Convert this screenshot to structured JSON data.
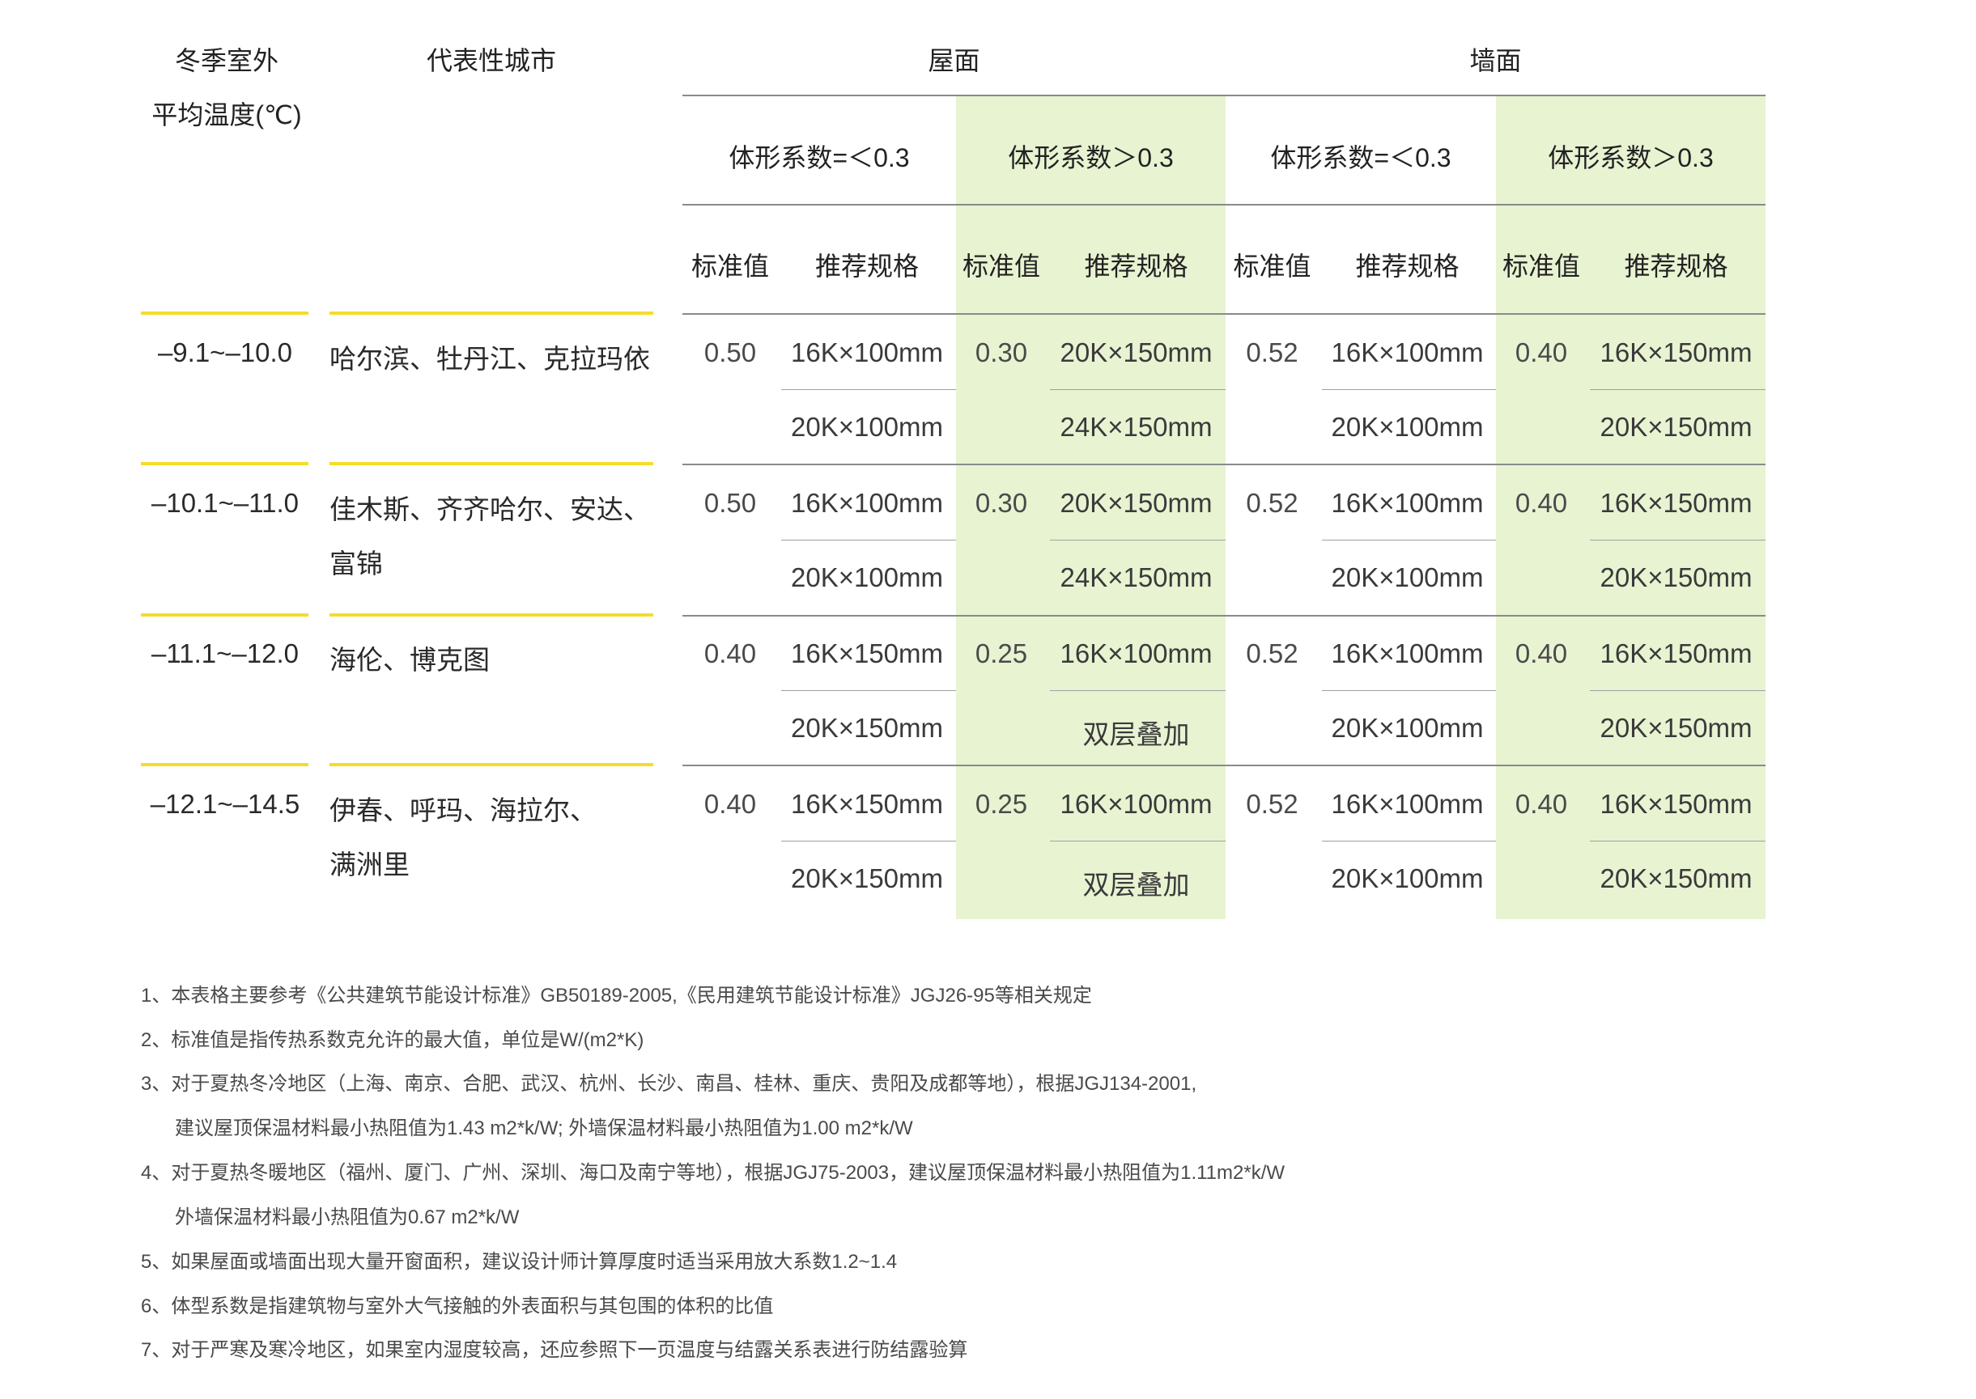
{
  "header": {
    "col1_line1": "冬季室外",
    "col1_line2": "平均温度(℃)",
    "col2": "代表性城市",
    "roof": "屋面",
    "wall": "墙面",
    "shape_le": "体形系数=＜0.3",
    "shape_gt": "体形系数＞0.3",
    "std": "标准值",
    "rec": "推荐规格"
  },
  "rows": [
    {
      "temp": "–9.1~–10.0",
      "city_line1": "哈尔滨、牡丹江、克拉玛依",
      "city_line2": "",
      "roof_le_std": "0.50",
      "roof_le_spec1": "16K×100mm",
      "roof_le_spec2": "20K×100mm",
      "roof_gt_std": "0.30",
      "roof_gt_spec1": "20K×150mm",
      "roof_gt_spec2": "24K×150mm",
      "wall_le_std": "0.52",
      "wall_le_spec1": "16K×100mm",
      "wall_le_spec2": "20K×100mm",
      "wall_gt_std": "0.40",
      "wall_gt_spec1": "16K×150mm",
      "wall_gt_spec2": "20K×150mm"
    },
    {
      "temp": "–10.1~–11.0",
      "city_line1": "佳木斯、齐齐哈尔、安达、",
      "city_line2": "富锦",
      "roof_le_std": "0.50",
      "roof_le_spec1": "16K×100mm",
      "roof_le_spec2": "20K×100mm",
      "roof_gt_std": "0.30",
      "roof_gt_spec1": "20K×150mm",
      "roof_gt_spec2": "24K×150mm",
      "wall_le_std": "0.52",
      "wall_le_spec1": "16K×100mm",
      "wall_le_spec2": "20K×100mm",
      "wall_gt_std": "0.40",
      "wall_gt_spec1": "16K×150mm",
      "wall_gt_spec2": "20K×150mm"
    },
    {
      "temp": "–11.1~–12.0",
      "city_line1": "海伦、博克图",
      "city_line2": "",
      "roof_le_std": "0.40",
      "roof_le_spec1": "16K×150mm",
      "roof_le_spec2": "20K×150mm",
      "roof_gt_std": "0.25",
      "roof_gt_spec1": "16K×100mm",
      "roof_gt_spec2": "双层叠加",
      "wall_le_std": "0.52",
      "wall_le_spec1": "16K×100mm",
      "wall_le_spec2": "20K×100mm",
      "wall_gt_std": "0.40",
      "wall_gt_spec1": "16K×150mm",
      "wall_gt_spec2": "20K×150mm"
    },
    {
      "temp": "–12.1~–14.5",
      "city_line1": "伊春、呼玛、海拉尔、",
      "city_line2": "满洲里",
      "roof_le_std": "0.40",
      "roof_le_spec1": "16K×150mm",
      "roof_le_spec2": "20K×150mm",
      "roof_gt_std": "0.25",
      "roof_gt_spec1": "16K×100mm",
      "roof_gt_spec2": "双层叠加",
      "wall_le_std": "0.52",
      "wall_le_spec1": "16K×100mm",
      "wall_le_spec2": "20K×100mm",
      "wall_gt_std": "0.40",
      "wall_gt_spec1": "16K×150mm",
      "wall_gt_spec2": "20K×150mm"
    }
  ],
  "notes": [
    "1、本表格主要参考《公共建筑节能设计标准》GB50189-2005,《民用建筑节能设计标准》JGJ26-95等相关规定",
    "2、标准值是指传热系数克允许的最大值，单位是W/(m2*K)",
    "3、对于夏热冬冷地区（上海、南京、合肥、武汉、杭州、长沙、南昌、桂林、重庆、贵阳及成都等地），根据JGJ134-2001,",
    "建议屋顶保温材料最小热阻值为1.43 m2*k/W; 外墙保温材料最小热阻值为1.00 m2*k/W",
    "4、对于夏热冬暖地区（福州、厦门、广州、深圳、海口及南宁等地），根据JGJ75-2003，建议屋顶保温材料最小热阻值为1.11m2*k/W",
    "外墙保温材料最小热阻值为0.67 m2*k/W",
    "5、如果屋面或墙面出现大量开窗面积，建议设计师计算厚度时适当采用放大系数1.2~1.4",
    "6、体型系数是指建筑物与室外大气接触的外表面积与其包围的体积的比值",
    "7、对于严寒及寒冷地区，如果室内湿度较高，还应参照下一页温度与结露关系表进行防结露验算"
  ],
  "colors": {
    "green": "#e8f3d2",
    "yellow": "#f5dc2a",
    "rule": "#8a8a8a"
  }
}
